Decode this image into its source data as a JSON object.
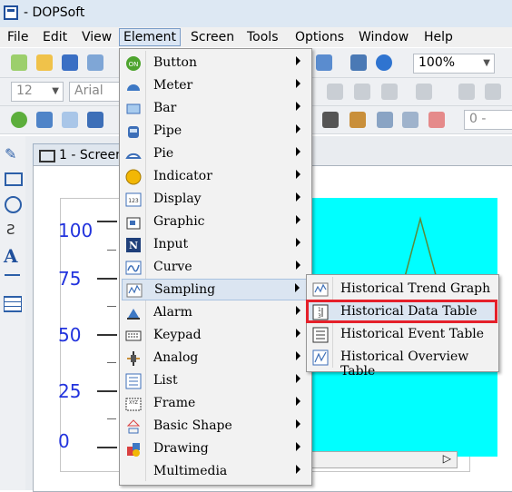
{
  "window": {
    "title": "- DOPSoft"
  },
  "menubar": [
    "File",
    "Edit",
    "View",
    "Element",
    "Screen",
    "Tools",
    "Options",
    "Window",
    "Help"
  ],
  "toolbar": {
    "zoom": "100%",
    "font_size": "12",
    "font_name": "Arial",
    "offset_value": "0 -"
  },
  "screen_tab": "1 - Screen",
  "scale_labels": [
    "100",
    "75",
    "50",
    "25",
    "0"
  ],
  "element_menu": [
    {
      "label": "Button",
      "icon": "button-icon"
    },
    {
      "label": "Meter",
      "icon": "meter-icon"
    },
    {
      "label": "Bar",
      "icon": "bar-icon"
    },
    {
      "label": "Pipe",
      "icon": "pipe-icon"
    },
    {
      "label": "Pie",
      "icon": "pie-icon"
    },
    {
      "label": "Indicator",
      "icon": "indicator-icon"
    },
    {
      "label": "Display",
      "icon": "display-icon"
    },
    {
      "label": "Graphic",
      "icon": "graphic-icon"
    },
    {
      "label": "Input",
      "icon": "input-icon"
    },
    {
      "label": "Curve",
      "icon": "curve-icon"
    },
    {
      "label": "Sampling",
      "icon": "sampling-icon"
    },
    {
      "label": "Alarm",
      "icon": "alarm-icon"
    },
    {
      "label": "Keypad",
      "icon": "keypad-icon"
    },
    {
      "label": "Analog",
      "icon": "analog-icon"
    },
    {
      "label": "List",
      "icon": "list-icon"
    },
    {
      "label": "Frame",
      "icon": "frame-icon"
    },
    {
      "label": "Basic Shape",
      "icon": "basic-shape-icon"
    },
    {
      "label": "Drawing",
      "icon": "drawing-icon"
    },
    {
      "label": "Multimedia",
      "icon": ""
    }
  ],
  "sampling_submenu": [
    {
      "label": "Historical Trend Graph",
      "icon": "trend-graph-icon"
    },
    {
      "label": "Historical Data Table",
      "icon": "data-table-icon"
    },
    {
      "label": "Historical Event Table",
      "icon": "event-table-icon"
    },
    {
      "label": "Historical Overview Table",
      "icon": "overview-table-icon"
    }
  ],
  "colors": {
    "highlight_box": "#e5202a",
    "canvas_fill": "#00ffff",
    "scale_text": "#2233dd"
  }
}
